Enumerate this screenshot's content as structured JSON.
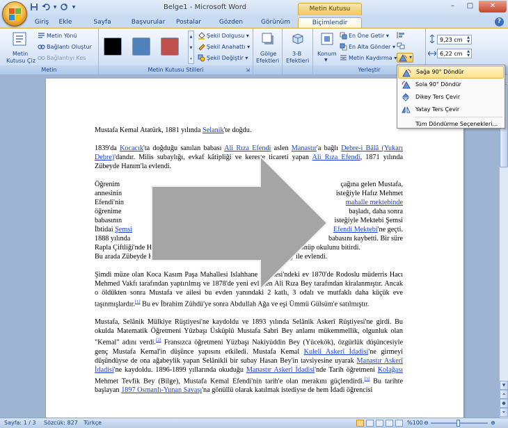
{
  "window": {
    "title": "Belge1 - Microsoft Word",
    "context_tab_title": "Metin Kutusu Araçları"
  },
  "qat": {
    "save_icon": "save-icon",
    "undo_icon": "undo-icon",
    "redo_icon": "redo-icon"
  },
  "window_controls": {
    "minimize": "–",
    "maximize": "□",
    "close": "✕"
  },
  "tabs": [
    {
      "label": "Giriş"
    },
    {
      "label": "Ekle"
    },
    {
      "label": "Sayfa Düzeni"
    },
    {
      "label": "Başvurular"
    },
    {
      "label": "Postalar"
    },
    {
      "label": "Gözden Geçir"
    },
    {
      "label": "Görünüm"
    },
    {
      "label": "Biçimlendir"
    }
  ],
  "help": "?",
  "ribbon": {
    "metin": {
      "draw_label1": "Metin",
      "draw_label2": "Kutusu Çiz",
      "direction": "Metin Yönü",
      "create_link": "Bağlantı Oluştur",
      "break_link": "Bağlantıyı Kes",
      "group_label": "Metin"
    },
    "styles": {
      "swatches": [
        "#000000",
        "#4f81bd",
        "#c0504d"
      ],
      "fill": "Şekil Dolgusu",
      "outline": "Şekil Anahattı",
      "change": "Şekil Değiştir",
      "group_label": "Metin Kutusu Stilleri"
    },
    "shadow": {
      "label1": "Gölge",
      "label2": "Efektleri"
    },
    "threed": {
      "label1": "3-B",
      "label2": "Efektleri"
    },
    "arrange": {
      "position": "Konum",
      "bring_front": "En Öne Getir",
      "send_back": "En Alta Gönder",
      "wrap": "Metin Kaydırma",
      "group_label": "Yerleştir"
    },
    "size": {
      "height": "9,23 cm",
      "width": "6,22 cm"
    }
  },
  "rotate_menu": {
    "items": [
      {
        "label": "Sağa 90° Döndür"
      },
      {
        "label": "Sola 90° Döndür"
      },
      {
        "label": "Dikey Ters Çevir"
      },
      {
        "label": "Yatay Ters Çevir"
      },
      {
        "label": "Tüm Döndürme Seçenekleri..."
      }
    ]
  },
  "document": {
    "p1": {
      "a": "Mustafa Kemal Atatürk, 1881 yılında ",
      "link1": "Selanik",
      "b": "'te doğdu."
    },
    "p2": {
      "a": "1839'da ",
      "link1": "Kocacık",
      "b": "'ta doğduğu sanılan babası ",
      "link2": "Ali Rıza Efendi",
      "c": " aslen ",
      "link3": "Manastır",
      "d": "'a bağlı ",
      "link4": "Debre-i Bâlâ (Yukarı Debre)",
      "e": "'dandır. Milis subaylığı, evkaf kâtipliği ve kereste ticareti yapan ",
      "link5": "Ali Rıza Efendi",
      "f": ", 1871 yılında Zübeyde Hanım'la evlendi."
    },
    "p3": {
      "l1a": "Öğrenim",
      "l1b": "çağına gelen Mustafa,",
      "l2a": "annesinin",
      "l2b": "isteğiyle Hafız Mehmet",
      "l3a": "Efendi'nin",
      "l3link": "mahalle mektebinde",
      "l4a": "öğrenime",
      "l4b": "başladı, daha sonra",
      "l5a": "babasının",
      "l5b": "isteğiyle Mektebi Şemsi",
      "l6a": "İbtidai ",
      "l6link": "Şemsi",
      "l6link2": "Efendi Mektebi",
      "l6b": "'ne geçti.",
      "l7a": "1888 yılında",
      "l7b": "babasını kaybetti. Bir süre",
      "l8": "Rapla Çiftliği'nde Hüseyin dayısının yanında kaldıktan sonra Selânik'e dönüp okulunu bitirdi.",
      "l9": "Bu arada Zübeyde Hanım, Selanik'te gümrük memuru olan Ragıp Bey ile evlendi."
    },
    "p4": {
      "a": "Şimdi müze olan Koca Kasım Paşa Mahallesi Islahhane Caddesi'ndeki ev 1870'de Rodoslu müderris Hacı Mehmed Vakfı tarafından yaptırılmış ve 1878'de yeni evlenen Ali Rıza Bey tarafından kiralanmıştır. Ancak o öldükten sonra Mustafa ve ailesi bu evden yanındaki 2 katlı, 3 odalı ve mutfaklı daha küçük eve taşınmışlardır.",
      "ref1": "[1]",
      "b": " Bu ev İbrahim Zühdü'ye sonra Abdullah Ağa ve eşi Ümmü Gülsüm'e satılmıştır."
    },
    "p5": {
      "a": "Mustafa, Selânik Mülkiye Rüştiyesi'ne kaydoldu ve 1893 yılında Selânik Askerî Rüştiyesi'ne girdi. Bu okulda Matematik Öğretmeni Yüzbaşı Üsküplü Mustafa Sabri Bey anlamı mükemmellik, olgunluk olan \"Kemal\" adını verdi.",
      "ref2": "[2]",
      "b": " Fransızca öğretmeni Yüzbaşı Nakiyüddin Bey (Yücekök), özgürlük düşüncesiyle genç Mustafa Kemal'in düşünce yapısını etkiledi. Mustafa Kemal ",
      "link1": "Kuleli Askerî İdadisi",
      "c": "'ne girmeyi düşündüyse de ona ağabeylik yapan Selânikli bir subay Hasan Bey'in tavsiyesine uyarak ",
      "link2": "Manastır Askerî İdadisi",
      "d": "'ne kaydoldu. 1896-1899 yıllarında okuduğu ",
      "link3": "Manastır Askerî İdadisi",
      "e": "'nde Tarih öğretmeni ",
      "link4": "Kolağası",
      "f": " Mehmet Tevfik Bey (Bilge), Mustafa Kemal Efendi'nin tarih'e olan merakını güçlendirdi.",
      "ref3": "[3]",
      "g": " Bu tarihte başlayan ",
      "link5": "1897 Osmanlı-Yunan Savaşı",
      "h": "'na gönüllü olarak katılmak istediyse de hem İdadi öğrencisi"
    }
  },
  "status": {
    "page": "Sayfa: 1 / 3",
    "words": "Sözcük: 827",
    "language": "Türkçe",
    "zoom": "%100"
  }
}
